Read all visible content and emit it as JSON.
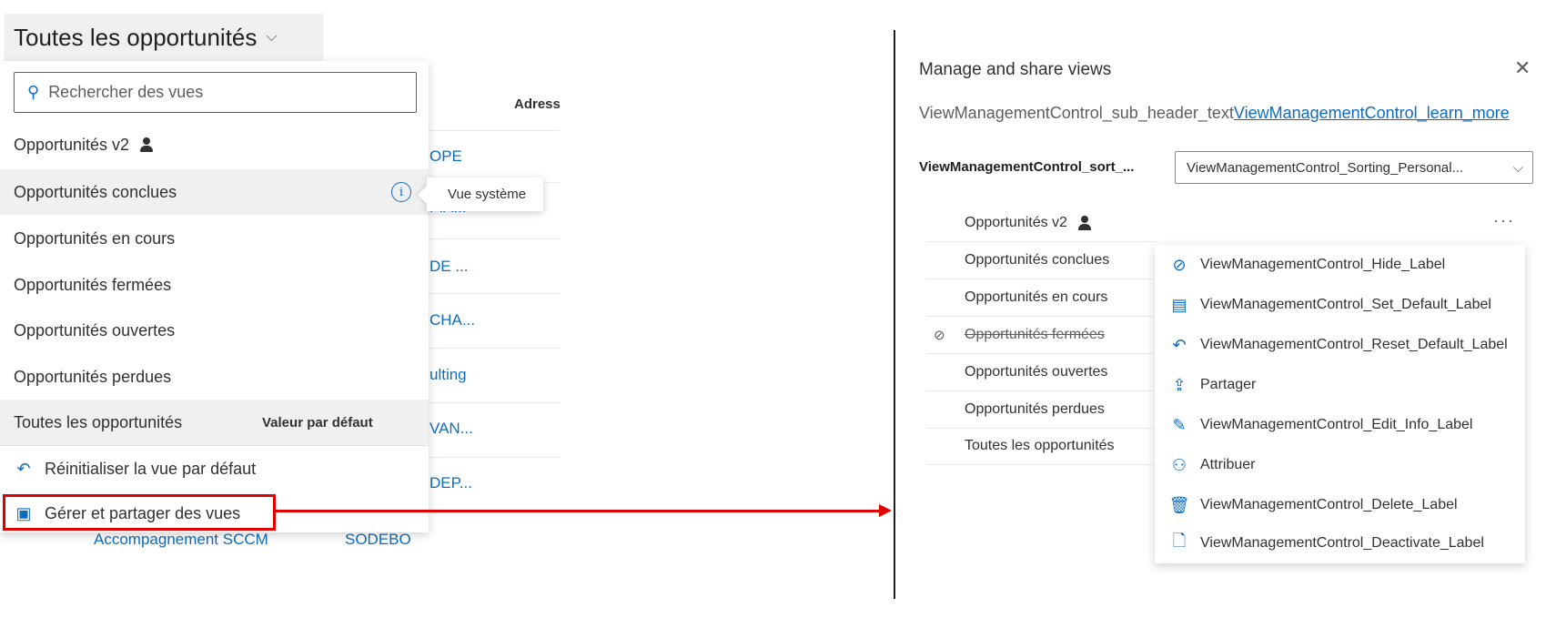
{
  "header": {
    "title": "Toutes les opportunités"
  },
  "grid": {
    "column_header": "Adress",
    "cells": [
      "OPE",
      "FIA...",
      "DE ...",
      "CHA...",
      "ulting",
      "VAN...",
      "DEP..."
    ],
    "below_row": {
      "name": "Accompagnement SCCM",
      "account": "SODEBO"
    }
  },
  "view_dropdown": {
    "search_placeholder": "Rechercher des vues",
    "items": [
      {
        "label": "Opportunités v2",
        "personal": true
      },
      {
        "label": "Opportunités conclues",
        "info": true
      },
      {
        "label": "Opportunités en cours"
      },
      {
        "label": "Opportunités fermées"
      },
      {
        "label": "Opportunités ouvertes"
      },
      {
        "label": "Opportunités perdues"
      },
      {
        "label": "Toutes les opportunités",
        "badge": "Valeur par défaut"
      }
    ],
    "tooltip": "Vue système",
    "reset_label": "Réinitialiser la vue par défaut",
    "manage_label": "Gérer et partager des vues"
  },
  "panel": {
    "title": "Manage and share views",
    "sub_header": "ViewManagementControl_sub_header_text",
    "learn_more": "ViewManagementControl_learn_more",
    "sort_label": "ViewManagementControl_sort_...",
    "sort_value": "ViewManagementControl_Sorting_Personal...",
    "views": [
      {
        "label": "Opportunités v2",
        "personal": true
      },
      {
        "label": "Opportunités conclues"
      },
      {
        "label": "Opportunités en cours"
      },
      {
        "label": "Opportunités fermées",
        "hidden": true
      },
      {
        "label": "Opportunités ouvertes"
      },
      {
        "label": "Opportunités perdues"
      },
      {
        "label": "Toutes les opportunités"
      }
    ],
    "more_icon": "ellipsis-icon",
    "menu": [
      {
        "label": "ViewManagementControl_Hide_Label",
        "icon": "hide-icon"
      },
      {
        "label": "ViewManagementControl_Set_Default_Label",
        "icon": "set-default-icon"
      },
      {
        "label": "ViewManagementControl_Reset_Default_Label",
        "icon": "reset-icon"
      },
      {
        "label": "Partager",
        "icon": "share-icon"
      },
      {
        "label": "ViewManagementControl_Edit_Info_Label",
        "icon": "edit-icon"
      },
      {
        "label": "Attribuer",
        "icon": "assign-icon"
      },
      {
        "label": "ViewManagementControl_Delete_Label",
        "icon": "delete-icon"
      },
      {
        "label": "ViewManagementControl_Deactivate_Label",
        "icon": "deactivate-icon"
      }
    ]
  },
  "colors": {
    "accent": "#0f6cbd",
    "annotation": "#e00000"
  }
}
